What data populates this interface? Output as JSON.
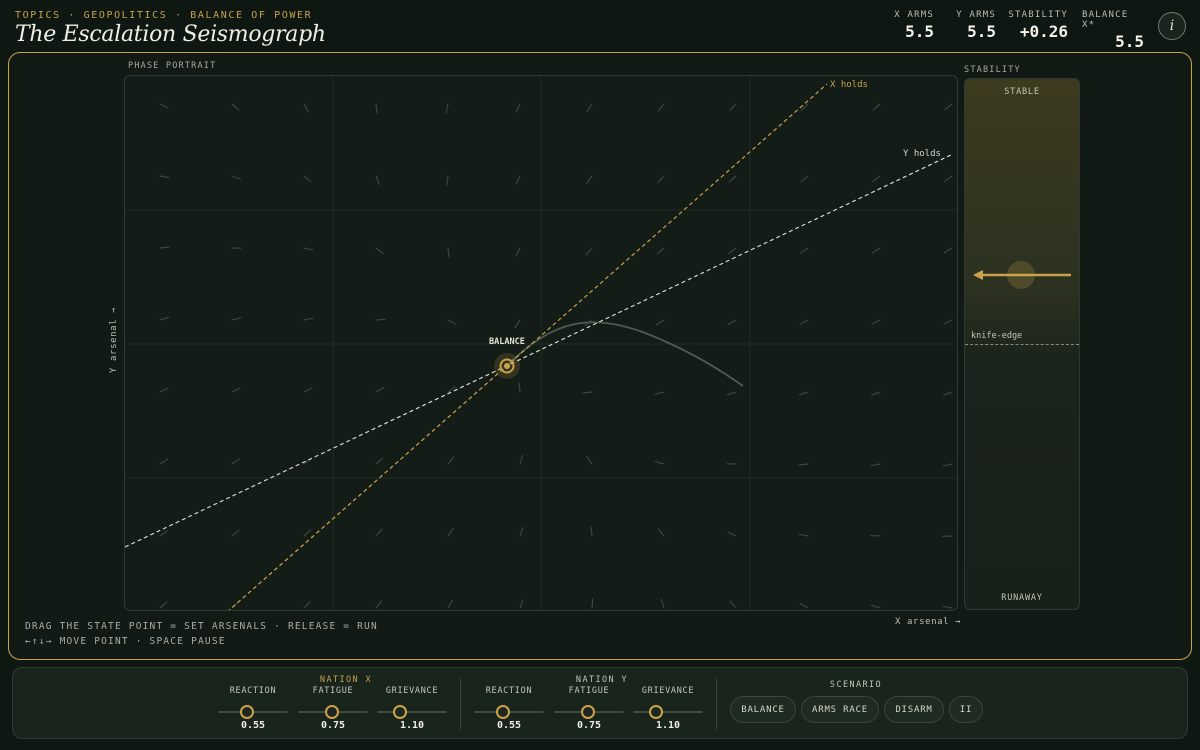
{
  "header": {
    "breadcrumb": "TOPICS · GEOPOLITICS · BALANCE OF POWER",
    "title": "The Escalation Seismograph",
    "stats": [
      {
        "label": "X ARMS",
        "value": "5.5"
      },
      {
        "label": "Y ARMS",
        "value": "5.5"
      },
      {
        "label": "STABILITY",
        "value": "+0.26"
      },
      {
        "label": "BALANCE X*",
        "value": "5.5"
      }
    ],
    "info_icon": "info-icon",
    "info_glyph": "i"
  },
  "plot": {
    "section_label": "PHASE PORTRAIT",
    "x_axis_label": "X arsenal →",
    "y_axis_label": "Y arsenal →",
    "x_nullcline_label": "X holds",
    "y_nullcline_label": "Y holds",
    "equilibrium_label": "BALANCE",
    "hint_line1": "DRAG THE STATE POINT = SET ARSENALS · RELEASE = RUN",
    "hint_line2": "←↑↓→ MOVE POINT · SPACE PAUSE",
    "colors": {
      "accent": "#c9a24a",
      "y_nullcline": "#d8d6c8"
    }
  },
  "stability": {
    "section_label": "STABILITY",
    "top_label": "STABLE",
    "bottom_label": "RUNAWAY",
    "threshold_label": "knife-edge",
    "value": 0.26,
    "threshold": 0.0
  },
  "controls": {
    "nation_x": {
      "title": "NATION X",
      "sliders": [
        {
          "label": "REACTION",
          "value": "0.55",
          "level": 0.42
        },
        {
          "label": "FATIGUE",
          "value": "0.75",
          "level": 0.48
        },
        {
          "label": "GRIEVANCE",
          "value": "1.10",
          "level": 0.33
        }
      ]
    },
    "nation_y": {
      "title": "NATION Y",
      "sliders": [
        {
          "label": "REACTION",
          "value": "0.55",
          "level": 0.42
        },
        {
          "label": "FATIGUE",
          "value": "0.75",
          "level": 0.48
        },
        {
          "label": "GRIEVANCE",
          "value": "1.10",
          "level": 0.33
        }
      ]
    },
    "scenario": {
      "title": "SCENARIO",
      "buttons": [
        "BALANCE",
        "ARMS RACE",
        "DISARM"
      ],
      "pause_label": "II"
    }
  }
}
